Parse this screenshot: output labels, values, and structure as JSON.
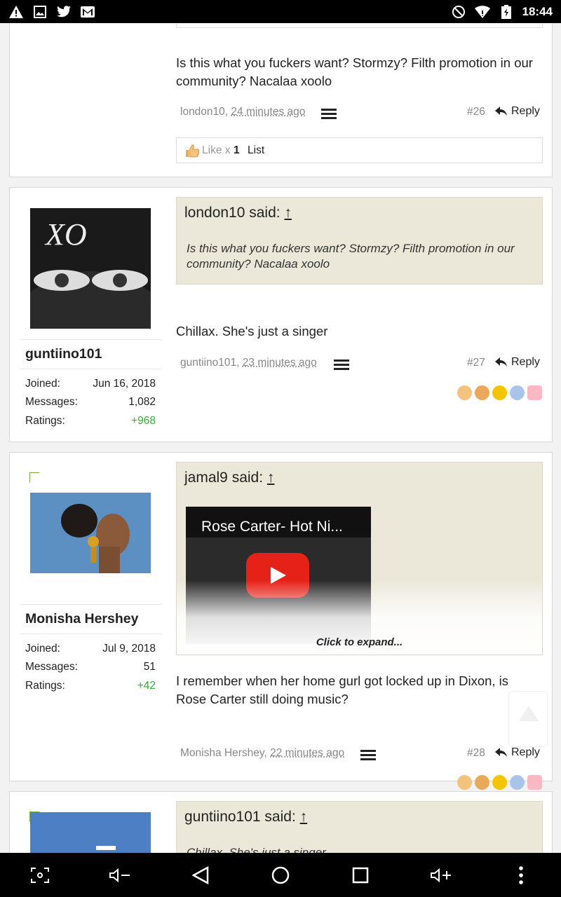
{
  "status_bar": {
    "time": "18:44",
    "left_icons": [
      "warning-icon",
      "image-icon",
      "twitter-icon",
      "gmail-icon"
    ],
    "right_icons": [
      "do-not-disturb-icon",
      "wifi-icon",
      "battery-icon"
    ]
  },
  "posts": [
    {
      "text": "Is this what you fuckers want? Stormzy? Filth promotion in our community? Nacalaa xoolo",
      "author": "london10,",
      "time": "24 minutes ago",
      "number": "#26",
      "reply_label": "Reply",
      "likes": {
        "prefix": "Like x",
        "count": "1",
        "list_label": "List"
      }
    },
    {
      "username": "guntiino101",
      "joined_label": "Joined:",
      "joined": "Jun 16, 2018",
      "messages_label": "Messages:",
      "messages": "1,082",
      "ratings_label": "Ratings:",
      "ratings": "+968",
      "avatar_text": "XO",
      "quote_head": "london10 said: ",
      "quote_arrow": "↑",
      "quote_body": "Is this what you fuckers want? Stormzy? Filth promotion in our community? Nacalaa xoolo",
      "text": "Chillax. She's just a singer",
      "author": "guntiino101,",
      "time": "23 minutes ago",
      "number": "#27",
      "reply_label": "Reply"
    },
    {
      "username": "Monisha Hershey",
      "joined_label": "Joined:",
      "joined": "Jul 9, 2018",
      "messages_label": "Messages:",
      "messages": "51",
      "ratings_label": "Ratings:",
      "ratings": "+42",
      "quote_head": "jamal9 said: ",
      "quote_arrow": "↑",
      "video_title": "Rose Carter- Hot Ni...",
      "expand_label": "Click to expand...",
      "text": "I remember when her home gurl got locked up in Dixon, is Rose Carter still doing music?",
      "author": "Monisha Hershey,",
      "time": "22 minutes ago",
      "number": "#28",
      "reply_label": "Reply"
    },
    {
      "quote_head": "guntiino101 said: ",
      "quote_arrow": "↑",
      "quote_body": "Chillax. She's just a singer"
    }
  ],
  "nav_bar": [
    "screenshot-icon",
    "volume-down-icon",
    "back-icon",
    "home-icon",
    "recents-icon",
    "volume-up-icon",
    "more-icon"
  ]
}
